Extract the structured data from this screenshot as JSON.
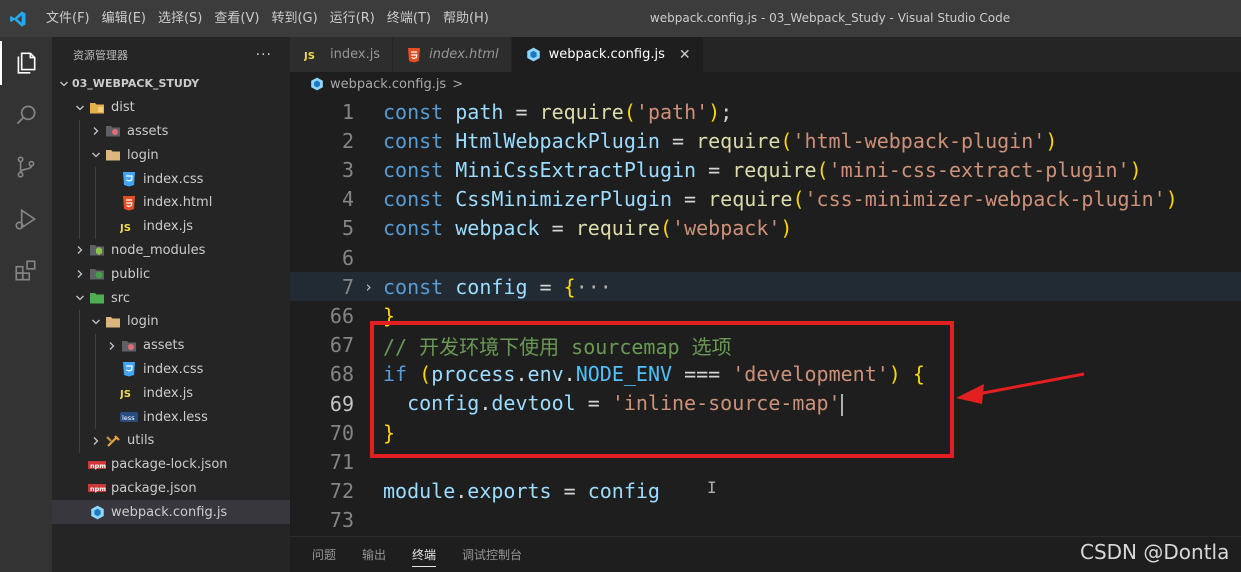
{
  "titlebar": {
    "menu": [
      "文件(F)",
      "编辑(E)",
      "选择(S)",
      "查看(V)",
      "转到(G)",
      "运行(R)",
      "终端(T)",
      "帮助(H)"
    ],
    "window_title": "webpack.config.js - 03_Webpack_Study - Visual Studio Code"
  },
  "sidebar": {
    "header": "资源管理器",
    "more": "···",
    "tree": [
      {
        "label": "03_WEBPACK_STUDY",
        "depth": 0,
        "chevron": "down",
        "icon": "none",
        "root": true
      },
      {
        "label": "dist",
        "depth": 1,
        "chevron": "down",
        "icon": "folder-dist-open-icon"
      },
      {
        "label": "assets",
        "depth": 2,
        "chevron": "right",
        "icon": "folder-assets-icon"
      },
      {
        "label": "login",
        "depth": 2,
        "chevron": "down",
        "icon": "folder-open-icon"
      },
      {
        "label": "index.css",
        "depth": 3,
        "chevron": "none",
        "icon": "css-file-icon"
      },
      {
        "label": "index.html",
        "depth": 3,
        "chevron": "none",
        "icon": "html-file-icon"
      },
      {
        "label": "index.js",
        "depth": 3,
        "chevron": "none",
        "icon": "js-file-icon"
      },
      {
        "label": "node_modules",
        "depth": 1,
        "chevron": "right",
        "icon": "folder-node-icon"
      },
      {
        "label": "public",
        "depth": 1,
        "chevron": "right",
        "icon": "folder-public-icon"
      },
      {
        "label": "src",
        "depth": 1,
        "chevron": "down",
        "icon": "folder-src-icon"
      },
      {
        "label": "login",
        "depth": 2,
        "chevron": "down",
        "icon": "folder-open-icon"
      },
      {
        "label": "assets",
        "depth": 3,
        "chevron": "right",
        "icon": "folder-assets-icon"
      },
      {
        "label": "index.css",
        "depth": 3,
        "chevron": "none",
        "icon": "css-file-icon"
      },
      {
        "label": "index.js",
        "depth": 3,
        "chevron": "none",
        "icon": "js-file-icon"
      },
      {
        "label": "index.less",
        "depth": 3,
        "chevron": "none",
        "icon": "less-file-icon"
      },
      {
        "label": "utils",
        "depth": 2,
        "chevron": "right",
        "icon": "folder-utils-icon"
      },
      {
        "label": "package-lock.json",
        "depth": 1,
        "chevron": "none",
        "icon": "npm-file-icon"
      },
      {
        "label": "package.json",
        "depth": 1,
        "chevron": "none",
        "icon": "npm-file-icon"
      },
      {
        "label": "webpack.config.js",
        "depth": 1,
        "chevron": "none",
        "icon": "webpack-file-icon",
        "selected": true
      }
    ]
  },
  "tabs": [
    {
      "label": "index.js",
      "icon": "js-file-icon",
      "active": false,
      "italic": false
    },
    {
      "label": "index.html",
      "icon": "html-file-icon",
      "active": false,
      "italic": true
    },
    {
      "label": "webpack.config.js",
      "icon": "webpack-file-icon",
      "active": true,
      "italic": false,
      "close": "✕"
    }
  ],
  "breadcrumb": {
    "file": "webpack.config.js",
    "sep": ">"
  },
  "editor": {
    "lines": [
      {
        "n": "1",
        "tokens": [
          [
            "kw",
            "const"
          ],
          [
            "code",
            " "
          ],
          [
            "var",
            "path"
          ],
          [
            "code",
            " = "
          ],
          [
            "fn",
            "require"
          ],
          [
            "br1",
            "("
          ],
          [
            "str",
            "'path'"
          ],
          [
            "br1",
            ")"
          ],
          [
            "code",
            ";"
          ]
        ]
      },
      {
        "n": "2",
        "tokens": [
          [
            "kw",
            "const"
          ],
          [
            "code",
            " "
          ],
          [
            "var",
            "HtmlWebpackPlugin"
          ],
          [
            "code",
            " = "
          ],
          [
            "fn",
            "require"
          ],
          [
            "br1",
            "("
          ],
          [
            "str",
            "'html-webpack-plugin'"
          ],
          [
            "br1",
            ")"
          ]
        ]
      },
      {
        "n": "3",
        "tokens": [
          [
            "kw",
            "const"
          ],
          [
            "code",
            " "
          ],
          [
            "var",
            "MiniCssExtractPlugin"
          ],
          [
            "code",
            " = "
          ],
          [
            "fn",
            "require"
          ],
          [
            "br1",
            "("
          ],
          [
            "str",
            "'mini-css-extract-plugin'"
          ],
          [
            "br1",
            ")"
          ]
        ]
      },
      {
        "n": "4",
        "tokens": [
          [
            "kw",
            "const"
          ],
          [
            "code",
            " "
          ],
          [
            "var",
            "CssMinimizerPlugin"
          ],
          [
            "code",
            " = "
          ],
          [
            "fn",
            "require"
          ],
          [
            "br1",
            "("
          ],
          [
            "str",
            "'css-minimizer-webpack-plugin'"
          ],
          [
            "br1",
            ")"
          ]
        ]
      },
      {
        "n": "5",
        "tokens": [
          [
            "kw",
            "const"
          ],
          [
            "code",
            " "
          ],
          [
            "var",
            "webpack"
          ],
          [
            "code",
            " = "
          ],
          [
            "fn",
            "require"
          ],
          [
            "br1",
            "("
          ],
          [
            "str",
            "'webpack'"
          ],
          [
            "br1",
            ")"
          ]
        ]
      },
      {
        "n": "6",
        "tokens": []
      },
      {
        "n": "7",
        "fold": "›",
        "highlight": true,
        "tokens": [
          [
            "kw",
            "const"
          ],
          [
            "code",
            " "
          ],
          [
            "var",
            "config"
          ],
          [
            "code",
            " = "
          ],
          [
            "br1",
            "{"
          ],
          [
            "ellip",
            "···"
          ]
        ]
      },
      {
        "n": "66",
        "tokens": [
          [
            "br1",
            "}"
          ]
        ]
      },
      {
        "n": "67",
        "tokens": [
          [
            "cm",
            "// 开发环境下使用 sourcemap 选项"
          ]
        ]
      },
      {
        "n": "68",
        "tokens": [
          [
            "kw",
            "if"
          ],
          [
            "code",
            " "
          ],
          [
            "br1",
            "("
          ],
          [
            "var",
            "process"
          ],
          [
            "code",
            "."
          ],
          [
            "var",
            "env"
          ],
          [
            "code",
            "."
          ],
          [
            "cst",
            "NODE_ENV"
          ],
          [
            "code",
            " === "
          ],
          [
            "str",
            "'development'"
          ],
          [
            "br1",
            ")"
          ],
          [
            "code",
            " "
          ],
          [
            "br1",
            "{"
          ]
        ]
      },
      {
        "n": "69",
        "current": true,
        "tokens": [
          [
            "code",
            "  "
          ],
          [
            "var",
            "config"
          ],
          [
            "code",
            "."
          ],
          [
            "var",
            "devtool"
          ],
          [
            "code",
            " = "
          ],
          [
            "str",
            "'inline-source-map'"
          ]
        ]
      },
      {
        "n": "70",
        "tokens": [
          [
            "br1",
            "}"
          ]
        ]
      },
      {
        "n": "71",
        "tokens": []
      },
      {
        "n": "72",
        "tokens": [
          [
            "var",
            "module"
          ],
          [
            "code",
            "."
          ],
          [
            "var",
            "exports"
          ],
          [
            "code",
            " = "
          ],
          [
            "var",
            "config"
          ]
        ]
      },
      {
        "n": "73",
        "tokens": []
      }
    ]
  },
  "panel": {
    "tabs": [
      {
        "label": "问题",
        "active": false
      },
      {
        "label": "输出",
        "active": false
      },
      {
        "label": "终端",
        "active": true
      },
      {
        "label": "调试控制台",
        "active": false
      }
    ]
  },
  "watermark": "CSDN @Dontla",
  "colors": {
    "annotation_red": "#e31f1f",
    "accent_blue": "#569cd6"
  }
}
